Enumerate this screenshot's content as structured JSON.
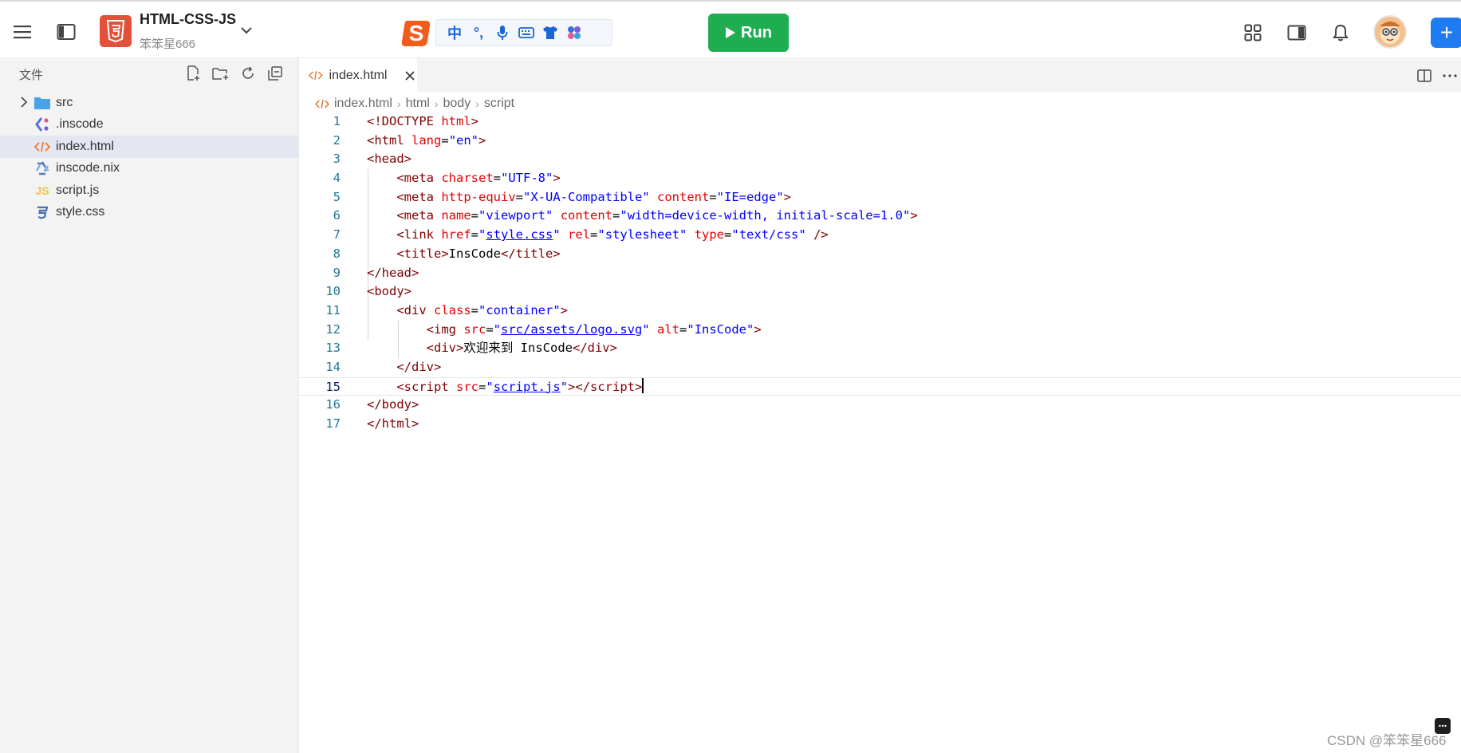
{
  "header": {
    "project_name": "HTML-CSS-JS",
    "project_owner": "笨笨星666",
    "run_label": "Run",
    "ime": {
      "chinese_label": "中",
      "punct_label": "°,"
    }
  },
  "sidebar": {
    "title": "文件",
    "items": [
      {
        "label": "src",
        "type": "folder",
        "icon": "folder-icon"
      },
      {
        "label": ".inscode",
        "type": "file",
        "icon": "inscode-icon"
      },
      {
        "label": "index.html",
        "type": "file",
        "icon": "html-file-icon",
        "selected": true
      },
      {
        "label": "inscode.nix",
        "type": "file",
        "icon": "nix-icon"
      },
      {
        "label": "script.js",
        "type": "file",
        "icon": "js-file-icon",
        "badge": "JS"
      },
      {
        "label": "style.css",
        "type": "file",
        "icon": "css-file-icon"
      }
    ]
  },
  "editor": {
    "tab_label": "index.html",
    "breadcrumb": [
      "index.html",
      "html",
      "body",
      "script"
    ],
    "active_line": 15,
    "lines": [
      {
        "n": "1"
      },
      {
        "n": "2"
      },
      {
        "n": "3"
      },
      {
        "n": "4"
      },
      {
        "n": "5"
      },
      {
        "n": "6"
      },
      {
        "n": "7"
      },
      {
        "n": "8"
      },
      {
        "n": "9"
      },
      {
        "n": "10"
      },
      {
        "n": "11"
      },
      {
        "n": "12"
      },
      {
        "n": "13"
      },
      {
        "n": "14"
      },
      {
        "n": "15"
      },
      {
        "n": "16"
      },
      {
        "n": "17"
      }
    ]
  },
  "watermark": "CSDN @笨笨星666",
  "colors": {
    "run_button": "#1fad52",
    "add_button": "#1e7cf2",
    "html_logo": "#e4513a",
    "tag": "#800000",
    "attr": "#e50000",
    "string": "#0000ff",
    "line_number": "#237893"
  }
}
